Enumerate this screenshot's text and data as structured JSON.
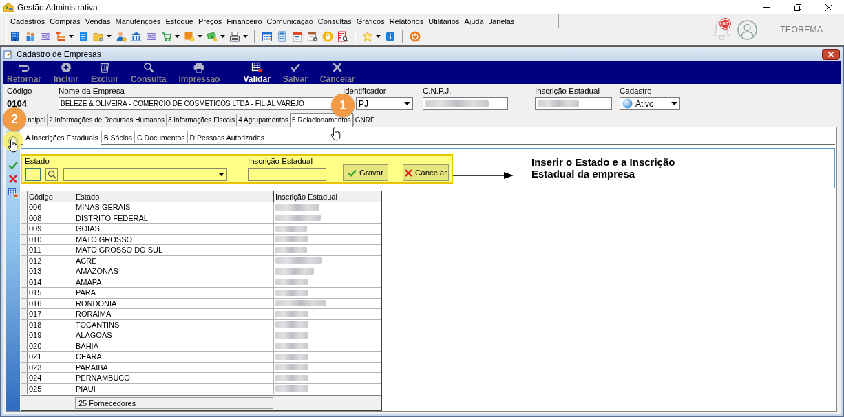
{
  "window": {
    "title": "Gestão Administrativa"
  },
  "menu": [
    "Cadastros",
    "Compras",
    "Vendas",
    "Manutenções",
    "Estoque",
    "Preços",
    "Financeiro",
    "Comunicação",
    "Consultas",
    "Gráficos",
    "Relatórios",
    "Utilitários",
    "Ajuda",
    "Janelas"
  ],
  "toolbar": [
    [
      {
        "kind": "building",
        "dropdown": false
      },
      {
        "kind": "people",
        "dropdown": false
      },
      {
        "kind": "card",
        "dropdown": false
      },
      {
        "kind": "hierarchy",
        "dropdown": true
      },
      {
        "kind": "document",
        "dropdown": false
      },
      {
        "kind": "folder",
        "dropdown": true
      },
      {
        "kind": "person",
        "dropdown": false
      },
      {
        "kind": "bank",
        "dropdown": false
      },
      {
        "kind": "card",
        "dropdown": false
      },
      {
        "kind": "cart",
        "dropdown": true
      },
      {
        "kind": "box",
        "dropdown": true
      },
      {
        "kind": "money",
        "dropdown": true
      },
      {
        "kind": "register",
        "dropdown": true
      }
    ],
    [
      {
        "kind": "schedule",
        "dropdown": false
      },
      {
        "kind": "calculator",
        "dropdown": false
      },
      {
        "kind": "calendar",
        "dropdown": false
      },
      {
        "kind": "planner",
        "dropdown": false
      },
      {
        "kind": "lock",
        "dropdown": false
      },
      {
        "kind": "report",
        "dropdown": false
      }
    ],
    [
      {
        "kind": "star",
        "dropdown": true
      },
      {
        "kind": "info",
        "dropdown": false
      }
    ],
    [
      {
        "kind": "power",
        "dropdown": false
      }
    ]
  ],
  "user_area": {
    "notifications": "00",
    "user": "TEOREMA"
  },
  "form_window": {
    "title": "Cadastro de Empresas"
  },
  "actions": [
    [
      {
        "label": "Retornar",
        "kind": "return",
        "disabled": true
      },
      {
        "label": "Incluir",
        "kind": "add",
        "disabled": true
      },
      {
        "label": "Excluir",
        "kind": "delete",
        "disabled": true
      },
      {
        "label": "Consulta",
        "kind": "search",
        "disabled": true
      },
      {
        "label": "Impressão",
        "kind": "print",
        "disabled": true
      }
    ],
    [
      {
        "label": "Validar",
        "kind": "validate",
        "disabled": false
      },
      {
        "label": "Salvar",
        "kind": "save",
        "disabled": true
      },
      {
        "label": "Cancelar",
        "kind": "cancel",
        "disabled": true
      }
    ]
  ],
  "company": {
    "code": {
      "label": "Código",
      "value": "0104"
    },
    "name": {
      "label": "Nome da Empresa",
      "value": "BELEZE & OLIVEIRA - COMERCIO DE COSMETICOS LTDA - FILIAL VAREJO"
    },
    "identifier": {
      "label": "Identificador",
      "value": "PJ"
    },
    "cnpj": {
      "label": "C.N.P.J.",
      "blurred": true
    },
    "state_registration": {
      "label": "Inscrição Estadual",
      "blurred": true
    },
    "status": {
      "label": "Cadastro",
      "value": "Ativo"
    }
  },
  "tabs": [
    {
      "label": "ncipal",
      "selected": false
    },
    {
      "label": "2 Informações de Recursos Humanos",
      "selected": false
    },
    {
      "label": "3 Informações Fiscais",
      "selected": false
    },
    {
      "label": "4 Agrupamentos",
      "selected": false
    },
    {
      "label": "5 Relacionamentos",
      "selected": true
    },
    {
      "label": "GNRE",
      "selected": false
    }
  ],
  "subtabs": [
    {
      "label": "A Inscrições Estaduais",
      "selected": true
    },
    {
      "label": "B Sócios",
      "selected": false
    },
    {
      "label": "C Documentos",
      "selected": false
    },
    {
      "label": "D Pessoas Autorizadas",
      "selected": false
    }
  ],
  "side_tools": [
    [
      {
        "kind": "add",
        "highlighted": true
      }
    ],
    [
      {
        "kind": "confirm",
        "highlighted": false
      },
      {
        "kind": "cancel",
        "highlighted": false
      },
      {
        "kind": "grid",
        "highlighted": false
      }
    ]
  ],
  "entry": {
    "highlighted": true,
    "state_label": "Estado",
    "registration_label": "Inscrição Estadual",
    "buttons": [
      {
        "label": "Gravar",
        "kind": "save"
      },
      {
        "label": "Cancelar",
        "kind": "cancel"
      }
    ]
  },
  "annotation": "Inserir o Estado e a Inscrição Estadual da empresa",
  "callouts": [
    {
      "number": "1"
    },
    {
      "number": "2"
    }
  ],
  "table": {
    "columns": [
      "Código",
      "Estado",
      "Inscrição Estadual"
    ],
    "rows": [
      {
        "code": "006",
        "state": "MINAS GERAIS",
        "registration_blurred": true
      },
      {
        "code": "008",
        "state": "DISTRITO FEDERAL",
        "registration_blurred": true
      },
      {
        "code": "009",
        "state": "GOIAS",
        "registration_blurred": true
      },
      {
        "code": "010",
        "state": "MATO GROSSO",
        "registration_blurred": true
      },
      {
        "code": "011",
        "state": "MATO GROSSO DO SUL",
        "registration_blurred": true
      },
      {
        "code": "012",
        "state": "ACRE",
        "registration_blurred": true
      },
      {
        "code": "013",
        "state": "AMAZONAS",
        "registration_blurred": true
      },
      {
        "code": "014",
        "state": "AMAPA",
        "registration_blurred": true
      },
      {
        "code": "015",
        "state": "PARA",
        "registration_blurred": true
      },
      {
        "code": "016",
        "state": "RONDONIA",
        "registration_blurred": true
      },
      {
        "code": "017",
        "state": "RORAIMA",
        "registration_blurred": true
      },
      {
        "code": "018",
        "state": "TOCANTINS",
        "registration_blurred": true
      },
      {
        "code": "019",
        "state": "ALAGOAS",
        "registration_blurred": true
      },
      {
        "code": "020",
        "state": "BAHIA",
        "registration_blurred": true
      },
      {
        "code": "021",
        "state": "CEARA",
        "registration_blurred": true
      },
      {
        "code": "023",
        "state": "PARAIBA",
        "registration_blurred": true
      },
      {
        "code": "024",
        "state": "PERNAMBUCO",
        "registration_blurred": true
      },
      {
        "code": "025",
        "state": "PIAUI",
        "registration_blurred": true
      }
    ],
    "footer": "25 Fornecedores"
  }
}
